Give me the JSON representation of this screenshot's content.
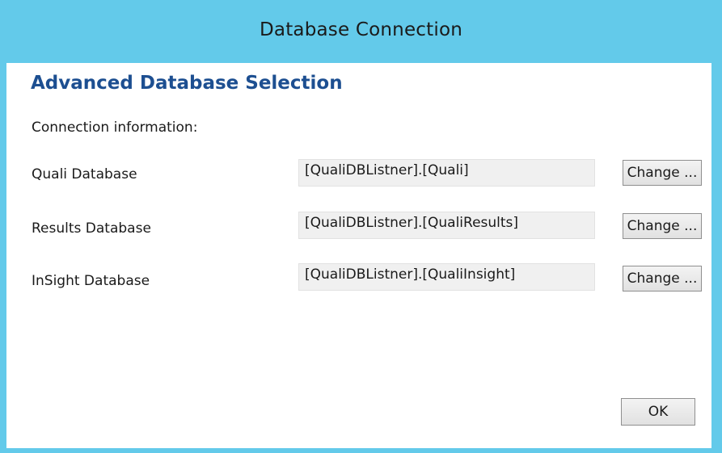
{
  "window": {
    "title": "Database Connection"
  },
  "dialog": {
    "heading": "Advanced Database Selection",
    "subheading": "Connection information:",
    "rows": [
      {
        "label": "Quali Database",
        "value": "[QualiDBListner].[Quali]",
        "button": "Change ..."
      },
      {
        "label": "Results Database",
        "value": "[QualiDBListner].[QualiResults]",
        "button": "Change ..."
      },
      {
        "label": "InSight Database",
        "value": "[QualiDBListner].[QualiInsight]",
        "button": "Change ..."
      }
    ],
    "ok_label": "OK"
  }
}
